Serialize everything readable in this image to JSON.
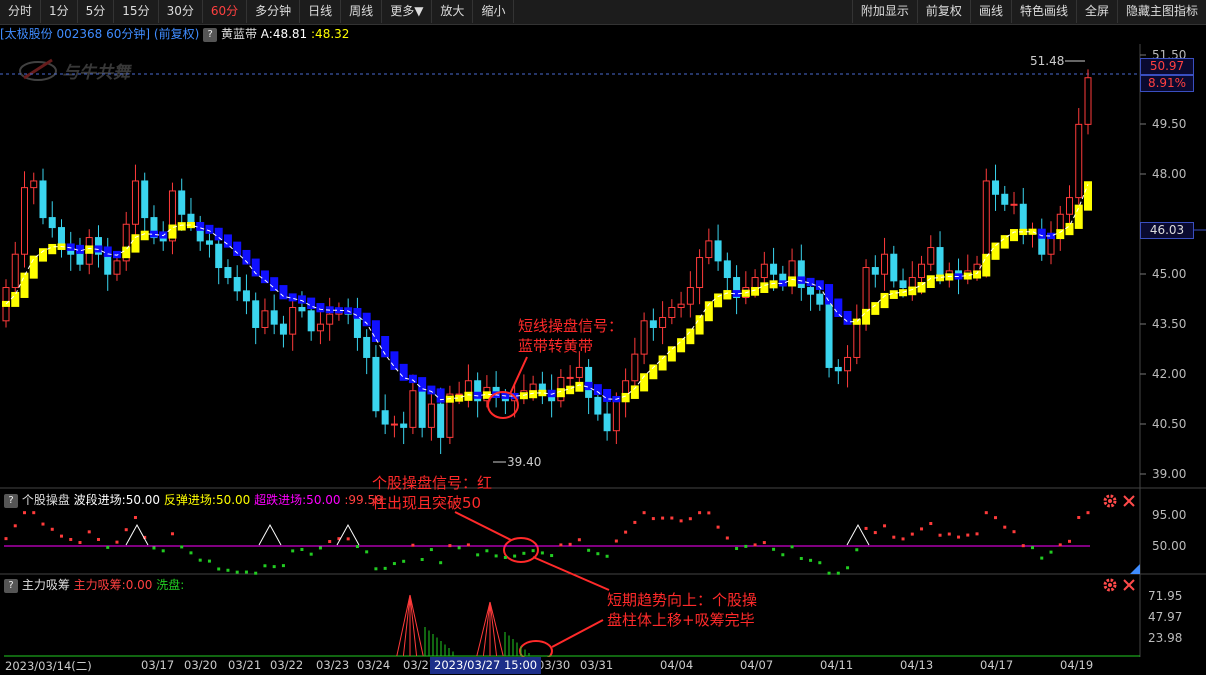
{
  "toolbar": {
    "left": [
      "分时",
      "1分",
      "5分",
      "15分",
      "30分",
      "60分",
      "多分钟",
      "日线",
      "周线",
      "更多▼",
      "放大",
      "缩小"
    ],
    "active_index": 5,
    "right": [
      "附加显示",
      "前复权",
      "画线",
      "特色画线",
      "全屏",
      "隐藏主图指标"
    ]
  },
  "info": {
    "stock": "[太极股份 002368 60分钟]",
    "adjust": "(前复权)",
    "help": "?",
    "indicator": "黄蓝带",
    "a_value": "A:48.81",
    "b_value": ":48.32"
  },
  "watermark": "与牛共舞",
  "main_axis": {
    "labels": [
      "51.50",
      "49.50",
      "48.00",
      "46.00",
      "45.00",
      "43.50",
      "42.00",
      "40.50",
      "39.00"
    ],
    "values": [
      51.5,
      49.5,
      48.0,
      46.0,
      45.0,
      43.5,
      42.0,
      40.5,
      39.0
    ]
  },
  "price_markers": {
    "high_label": "51.48",
    "low_label": "39.40",
    "current_price": "50.97",
    "current_pct": "8.91%",
    "level_price": "46.03"
  },
  "annotations": {
    "a1_line1": "短线操盘信号：",
    "a1_line2": "蓝带转黄带",
    "a2_line1": "个股操盘信号：红",
    "a2_line2": "柱出现且突破50",
    "a3_line1": "短期趋势向上：个股操",
    "a3_line2": "盘柱体上移+吸筹完毕"
  },
  "panel1": {
    "help": "?",
    "name": "个股操盘",
    "wave_label": "波段进场:50.00",
    "rebound_label": "反弹进场:50.00",
    "oversold_label": "超跌进场:50.00",
    "extra_value": ":99.59",
    "axis": [
      "95.00",
      "50.00"
    ]
  },
  "panel2": {
    "help": "?",
    "name": "主力吸筹",
    "main_label": "主力吸筹:0.00",
    "wash_label": "洗盘:",
    "axis": [
      "71.95",
      "47.97",
      "23.98"
    ]
  },
  "dates": {
    "labels": [
      "2023/03/14(二)",
      "03/17",
      "03/20",
      "03/21",
      "03/22",
      "03/23",
      "03/24",
      "03/27",
      "03/30",
      "03/31",
      "04/04",
      "04/07",
      "04/11",
      "04/13",
      "04/17",
      "04/19"
    ],
    "highlight": "2023/03/27 15:00"
  },
  "colors": {
    "up": "#ff3b3b",
    "down": "#3ad4ee",
    "yellow_band": "#ffff00",
    "blue_band": "#1010ff",
    "annotation": "#ff2a2a",
    "magenta": "#ff00ff",
    "green": "#22cc22"
  }
}
